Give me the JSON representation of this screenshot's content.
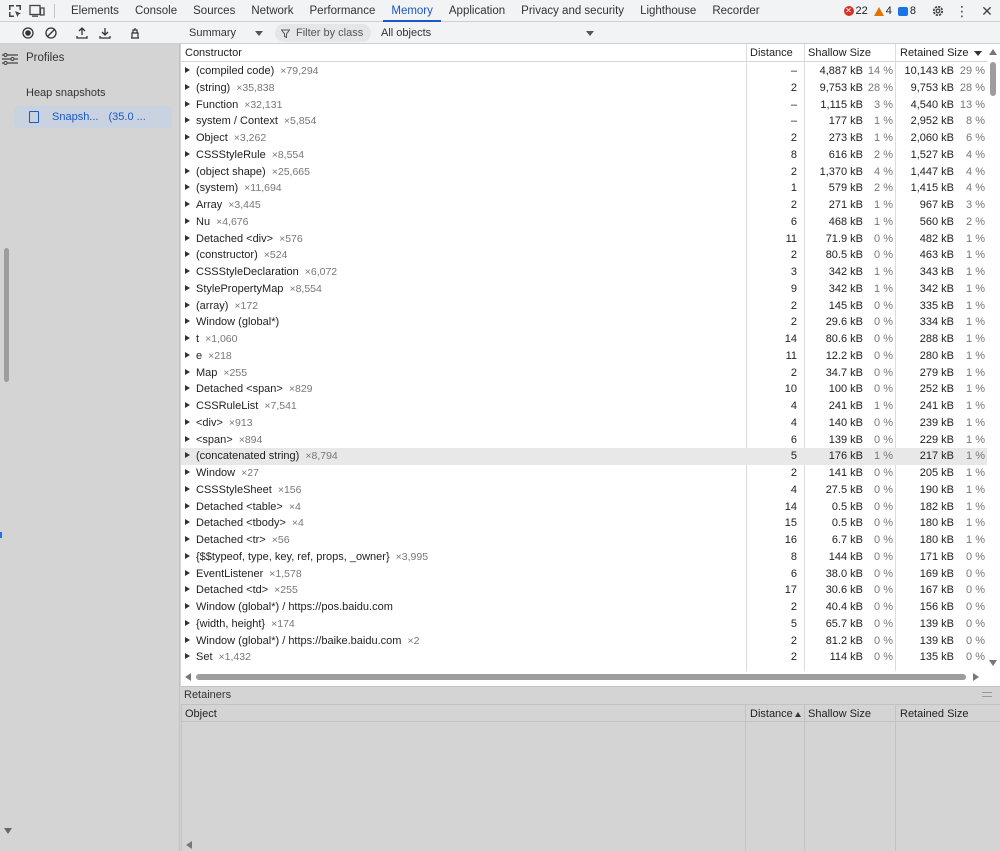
{
  "tabs": [
    "Elements",
    "Console",
    "Sources",
    "Network",
    "Performance",
    "Memory",
    "Application",
    "Privacy and security",
    "Lighthouse",
    "Recorder"
  ],
  "active_tab": "Memory",
  "issues": {
    "errors": "22",
    "warnings": "4",
    "messages": "8"
  },
  "toolbar": {
    "view": "Summary",
    "filter_placeholder": "Filter by class",
    "objects": "All objects"
  },
  "sidebar": {
    "profiles_label": "Profiles",
    "heap_title": "Heap snapshots",
    "snapshot_label": "Snapsh...",
    "snapshot_size": "(35.0 ..."
  },
  "table": {
    "headers": {
      "constructor": "Constructor",
      "distance": "Distance",
      "shallow": "Shallow Size",
      "retained": "Retained Size"
    },
    "rows": [
      {
        "name": "(compiled code)",
        "count": "×79,294",
        "distance": "–",
        "shallow": "4,887 kB",
        "shallow_pct": "14 %",
        "retained": "10,143 kB",
        "retained_pct": "29 %"
      },
      {
        "name": "(string)",
        "count": "×35,838",
        "distance": "2",
        "shallow": "9,753 kB",
        "shallow_pct": "28 %",
        "retained": "9,753 kB",
        "retained_pct": "28 %"
      },
      {
        "name": "Function",
        "count": "×32,131",
        "distance": "–",
        "shallow": "1,115 kB",
        "shallow_pct": "3 %",
        "retained": "4,540 kB",
        "retained_pct": "13 %"
      },
      {
        "name": "system / Context",
        "count": "×5,854",
        "distance": "–",
        "shallow": "177 kB",
        "shallow_pct": "1 %",
        "retained": "2,952 kB",
        "retained_pct": "8 %"
      },
      {
        "name": "Object",
        "count": "×3,262",
        "distance": "2",
        "shallow": "273 kB",
        "shallow_pct": "1 %",
        "retained": "2,060 kB",
        "retained_pct": "6 %"
      },
      {
        "name": "CSSStyleRule",
        "count": "×8,554",
        "distance": "8",
        "shallow": "616 kB",
        "shallow_pct": "2 %",
        "retained": "1,527 kB",
        "retained_pct": "4 %"
      },
      {
        "name": "(object shape)",
        "count": "×25,665",
        "distance": "2",
        "shallow": "1,370 kB",
        "shallow_pct": "4 %",
        "retained": "1,447 kB",
        "retained_pct": "4 %"
      },
      {
        "name": "(system)",
        "count": "×11,694",
        "distance": "1",
        "shallow": "579 kB",
        "shallow_pct": "2 %",
        "retained": "1,415 kB",
        "retained_pct": "4 %"
      },
      {
        "name": "Array",
        "count": "×3,445",
        "distance": "2",
        "shallow": "271 kB",
        "shallow_pct": "1 %",
        "retained": "967 kB",
        "retained_pct": "3 %"
      },
      {
        "name": "Nu",
        "count": "×4,676",
        "distance": "6",
        "shallow": "468 kB",
        "shallow_pct": "1 %",
        "retained": "560 kB",
        "retained_pct": "2 %"
      },
      {
        "name": "Detached <div>",
        "count": "×576",
        "distance": "11",
        "shallow": "71.9 kB",
        "shallow_pct": "0 %",
        "retained": "482 kB",
        "retained_pct": "1 %"
      },
      {
        "name": "(constructor)",
        "count": "×524",
        "distance": "2",
        "shallow": "80.5 kB",
        "shallow_pct": "0 %",
        "retained": "463 kB",
        "retained_pct": "1 %"
      },
      {
        "name": "CSSStyleDeclaration",
        "count": "×6,072",
        "distance": "3",
        "shallow": "342 kB",
        "shallow_pct": "1 %",
        "retained": "343 kB",
        "retained_pct": "1 %"
      },
      {
        "name": "StylePropertyMap",
        "count": "×8,554",
        "distance": "9",
        "shallow": "342 kB",
        "shallow_pct": "1 %",
        "retained": "342 kB",
        "retained_pct": "1 %"
      },
      {
        "name": "(array)",
        "count": "×172",
        "distance": "2",
        "shallow": "145 kB",
        "shallow_pct": "0 %",
        "retained": "335 kB",
        "retained_pct": "1 %"
      },
      {
        "name": "Window (global*)",
        "count": "",
        "distance": "2",
        "shallow": "29.6 kB",
        "shallow_pct": "0 %",
        "retained": "334 kB",
        "retained_pct": "1 %"
      },
      {
        "name": "t",
        "count": "×1,060",
        "distance": "14",
        "shallow": "80.6 kB",
        "shallow_pct": "0 %",
        "retained": "288 kB",
        "retained_pct": "1 %"
      },
      {
        "name": "e",
        "count": "×218",
        "distance": "11",
        "shallow": "12.2 kB",
        "shallow_pct": "0 %",
        "retained": "280 kB",
        "retained_pct": "1 %"
      },
      {
        "name": "Map",
        "count": "×255",
        "distance": "2",
        "shallow": "34.7 kB",
        "shallow_pct": "0 %",
        "retained": "279 kB",
        "retained_pct": "1 %"
      },
      {
        "name": "Detached <span>",
        "count": "×829",
        "distance": "10",
        "shallow": "100 kB",
        "shallow_pct": "0 %",
        "retained": "252 kB",
        "retained_pct": "1 %"
      },
      {
        "name": "CSSRuleList",
        "count": "×7,541",
        "distance": "4",
        "shallow": "241 kB",
        "shallow_pct": "1 %",
        "retained": "241 kB",
        "retained_pct": "1 %"
      },
      {
        "name": "<div>",
        "count": "×913",
        "distance": "4",
        "shallow": "140 kB",
        "shallow_pct": "0 %",
        "retained": "239 kB",
        "retained_pct": "1 %"
      },
      {
        "name": "<span>",
        "count": "×894",
        "distance": "6",
        "shallow": "139 kB",
        "shallow_pct": "0 %",
        "retained": "229 kB",
        "retained_pct": "1 %"
      },
      {
        "name": "(concatenated string)",
        "count": "×8,794",
        "distance": "5",
        "shallow": "176 kB",
        "shallow_pct": "1 %",
        "retained": "217 kB",
        "retained_pct": "1 %"
      },
      {
        "name": "Window",
        "count": "×27",
        "distance": "2",
        "shallow": "141 kB",
        "shallow_pct": "0 %",
        "retained": "205 kB",
        "retained_pct": "1 %"
      },
      {
        "name": "CSSStyleSheet",
        "count": "×156",
        "distance": "4",
        "shallow": "27.5 kB",
        "shallow_pct": "0 %",
        "retained": "190 kB",
        "retained_pct": "1 %"
      },
      {
        "name": "Detached <table>",
        "count": "×4",
        "distance": "14",
        "shallow": "0.5 kB",
        "shallow_pct": "0 %",
        "retained": "182 kB",
        "retained_pct": "1 %"
      },
      {
        "name": "Detached <tbody>",
        "count": "×4",
        "distance": "15",
        "shallow": "0.5 kB",
        "shallow_pct": "0 %",
        "retained": "180 kB",
        "retained_pct": "1 %"
      },
      {
        "name": "Detached <tr>",
        "count": "×56",
        "distance": "16",
        "shallow": "6.7 kB",
        "shallow_pct": "0 %",
        "retained": "180 kB",
        "retained_pct": "1 %"
      },
      {
        "name": "{$$typeof, type, key, ref, props, _owner}",
        "count": "×3,995",
        "distance": "8",
        "shallow": "144 kB",
        "shallow_pct": "0 %",
        "retained": "171 kB",
        "retained_pct": "0 %"
      },
      {
        "name": "EventListener",
        "count": "×1,578",
        "distance": "6",
        "shallow": "38.0 kB",
        "shallow_pct": "0 %",
        "retained": "169 kB",
        "retained_pct": "0 %"
      },
      {
        "name": "Detached <td>",
        "count": "×255",
        "distance": "17",
        "shallow": "30.6 kB",
        "shallow_pct": "0 %",
        "retained": "167 kB",
        "retained_pct": "0 %"
      },
      {
        "name": "Window (global*) / https://pos.baidu.com",
        "count": "",
        "distance": "2",
        "shallow": "40.4 kB",
        "shallow_pct": "0 %",
        "retained": "156 kB",
        "retained_pct": "0 %"
      },
      {
        "name": "{width, height}",
        "count": "×174",
        "distance": "5",
        "shallow": "65.7 kB",
        "shallow_pct": "0 %",
        "retained": "139 kB",
        "retained_pct": "0 %"
      },
      {
        "name": "Window (global*) / https://baike.baidu.com",
        "count": "×2",
        "distance": "2",
        "shallow": "81.2 kB",
        "shallow_pct": "0 %",
        "retained": "139 kB",
        "retained_pct": "0 %"
      },
      {
        "name": "Set",
        "count": "×1,432",
        "distance": "2",
        "shallow": "114 kB",
        "shallow_pct": "0 %",
        "retained": "135 kB",
        "retained_pct": "0 %"
      }
    ],
    "selected_row": 23
  },
  "retainers": {
    "title": "Retainers",
    "headers": {
      "object": "Object",
      "distance": "Distance",
      "shallow": "Shallow Size",
      "retained": "Retained Size"
    }
  }
}
